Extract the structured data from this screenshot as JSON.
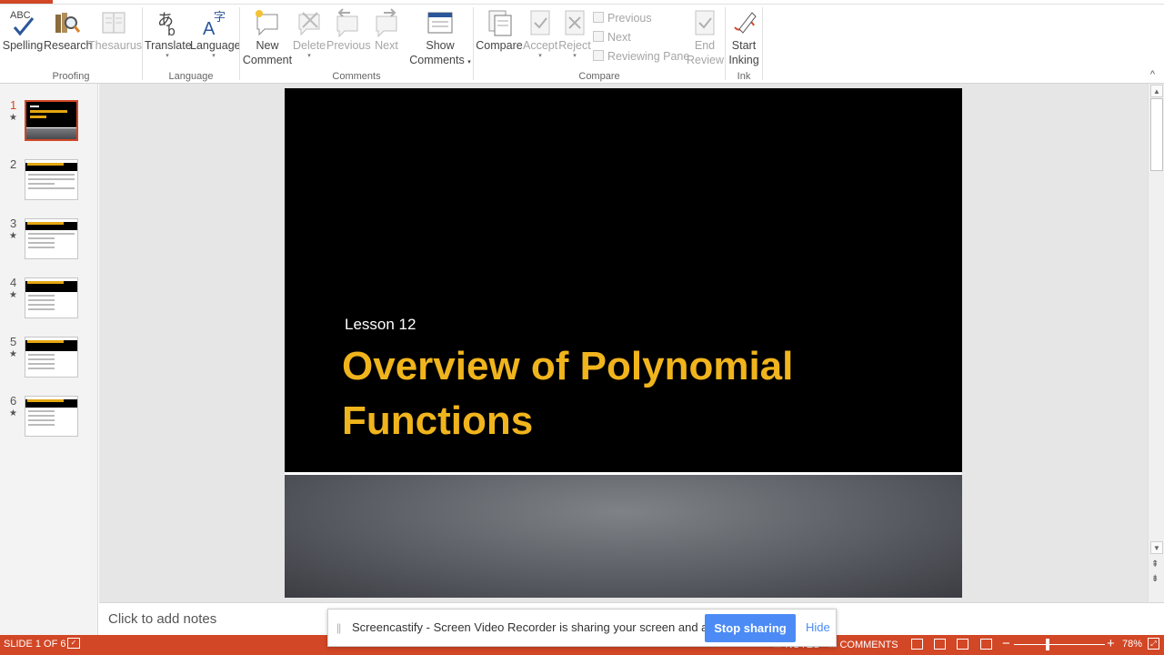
{
  "ribbon": {
    "groups": {
      "proofing": "Proofing",
      "language": "Language",
      "comments": "Comments",
      "compare": "Compare",
      "ink": "Ink"
    },
    "buttons": {
      "spelling": "Spelling",
      "spelling_abc": "ABC",
      "research": "Research",
      "thesaurus": "Thesaurus",
      "translate": "Translate",
      "language": "Language",
      "new_comment_1": "New",
      "new_comment_2": "Comment",
      "delete": "Delete",
      "previous": "Previous",
      "next": "Next",
      "show_comments_1": "Show",
      "show_comments_2": "Comments",
      "compare": "Compare",
      "accept": "Accept",
      "reject": "Reject",
      "cmp_previous": "Previous",
      "cmp_next": "Next",
      "reviewing_pane": "Reviewing Pane",
      "end_review_1": "End",
      "end_review_2": "Review",
      "start_inking_1": "Start",
      "start_inking_2": "Inking"
    }
  },
  "thumbnails": [
    {
      "num": "1",
      "active": true
    },
    {
      "num": "2",
      "active": false
    },
    {
      "num": "3",
      "active": false
    },
    {
      "num": "4",
      "active": false
    },
    {
      "num": "5",
      "active": false
    },
    {
      "num": "6",
      "active": false
    }
  ],
  "slide": {
    "subtitle": "Lesson 12",
    "title_line1": "Overview of Polynomial",
    "title_line2": "Functions"
  },
  "notes": {
    "placeholder": "Click to add notes"
  },
  "status": {
    "slide_indicator": "SLIDE 1 OF 6",
    "notes": "NOTES",
    "comments": "COMMENTS",
    "zoom": "78%",
    "zoom_level": 0.78
  },
  "sharebar": {
    "message": "Screencastify - Screen Video Recorder is sharing your screen and audio.",
    "stop": "Stop sharing",
    "hide": "Hide"
  },
  "colors": {
    "accent": "#d24726",
    "title": "#f0b41c",
    "share_button": "#4c8bf5"
  }
}
